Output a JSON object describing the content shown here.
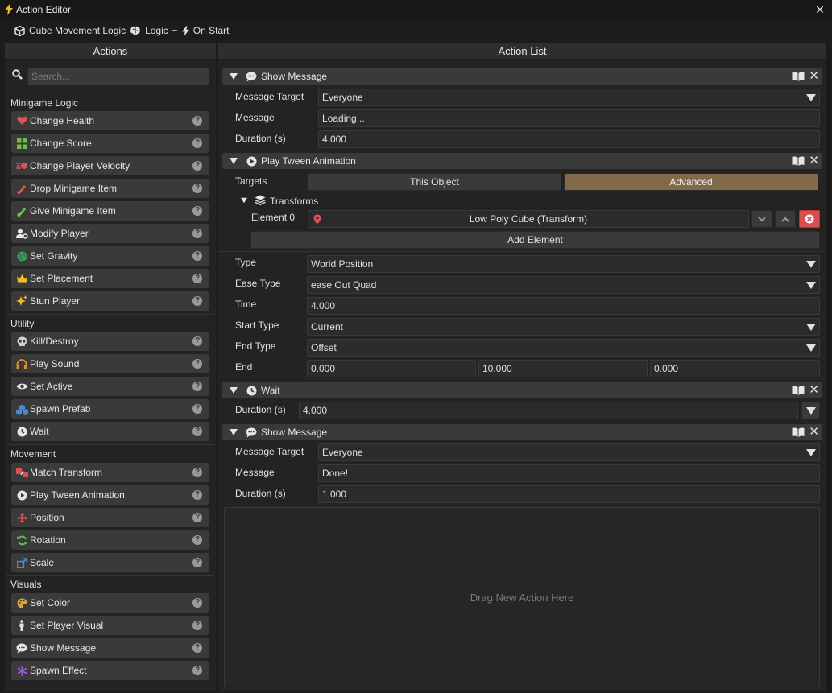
{
  "window": {
    "title": "Action Editor"
  },
  "breadcrumb": {
    "object": "Cube Movement Logic",
    "logic": "Logic",
    "separator": "~",
    "event": "On Start"
  },
  "panels": {
    "left_title": "Actions",
    "right_title": "Action List"
  },
  "search": {
    "placeholder": "Search..."
  },
  "categories": [
    {
      "name": "Minigame Logic",
      "items": [
        {
          "label": "Change Health",
          "icon": "heart-icon"
        },
        {
          "label": "Change Score",
          "icon": "grid-icon"
        },
        {
          "label": "Change Player Velocity",
          "icon": "dash-icon"
        },
        {
          "label": "Drop Minigame Item",
          "icon": "drop-item-icon"
        },
        {
          "label": "Give Minigame Item",
          "icon": "give-item-icon"
        },
        {
          "label": "Modify Player",
          "icon": "user-cog-icon"
        },
        {
          "label": "Set Gravity",
          "icon": "globe-icon"
        },
        {
          "label": "Set Placement",
          "icon": "crown-icon"
        },
        {
          "label": "Stun Player",
          "icon": "sparkle-icon"
        }
      ]
    },
    {
      "name": "Utility",
      "items": [
        {
          "label": "Kill/Destroy",
          "icon": "skull-icon"
        },
        {
          "label": "Play Sound",
          "icon": "headphones-icon"
        },
        {
          "label": "Set Active",
          "icon": "eye-icon"
        },
        {
          "label": "Spawn Prefab",
          "icon": "cubes-icon"
        },
        {
          "label": "Wait",
          "icon": "clock-icon"
        }
      ]
    },
    {
      "name": "Movement",
      "items": [
        {
          "label": "Match Transform",
          "icon": "match-icon"
        },
        {
          "label": "Play Tween Animation",
          "icon": "play-circle-icon"
        },
        {
          "label": "Position",
          "icon": "move-arrows-icon"
        },
        {
          "label": "Rotation",
          "icon": "rotate-icon"
        },
        {
          "label": "Scale",
          "icon": "scale-icon"
        }
      ]
    },
    {
      "name": "Visuals",
      "items": [
        {
          "label": "Set Color",
          "icon": "palette-icon"
        },
        {
          "label": "Set Player Visual",
          "icon": "person-icon"
        },
        {
          "label": "Show Message",
          "icon": "speech-bubble-icon"
        },
        {
          "label": "Spawn Effect",
          "icon": "snowflake-icon"
        }
      ]
    }
  ],
  "actions": {
    "show_message_1": {
      "title": "Show Message",
      "labels": {
        "target": "Message Target",
        "message": "Message",
        "duration": "Duration (s)"
      },
      "values": {
        "target": "Everyone",
        "message": "Loading...",
        "duration": "4.000"
      }
    },
    "tween": {
      "title": "Play Tween Animation",
      "targets_label": "Targets",
      "this_object": "This Object",
      "advanced": "Advanced",
      "transforms_label": "Transforms",
      "element_label": "Element 0",
      "element_value": "Low Poly Cube (Transform)",
      "add_element": "Add Element",
      "labels": {
        "type": "Type",
        "ease": "Ease Type",
        "time": "Time",
        "start": "Start Type",
        "end_type": "End Type",
        "end": "End"
      },
      "values": {
        "type": "World Position",
        "ease": "ease Out Quad",
        "time": "4.000",
        "start": "Current",
        "end_type": "Offset",
        "end_x": "0.000",
        "end_y": "10.000",
        "end_z": "0.000"
      }
    },
    "wait": {
      "title": "Wait",
      "duration_label": "Duration (s)",
      "duration": "4.000"
    },
    "show_message_2": {
      "title": "Show Message",
      "labels": {
        "target": "Message Target",
        "message": "Message",
        "duration": "Duration (s)"
      },
      "values": {
        "target": "Everyone",
        "message": "Done!",
        "duration": "1.000"
      }
    }
  },
  "drop_zone": "Drag New Action Here",
  "help_glyph": "?",
  "close_glyph": "✕",
  "colors": {
    "accent": "#806a4a",
    "bg": "#232323",
    "field": "#2b2b2b",
    "item": "#3a3a3a",
    "remove": "#d94e4e"
  }
}
